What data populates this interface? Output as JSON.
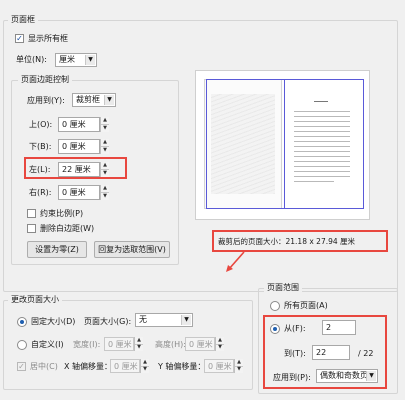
{
  "page_boxes": {
    "legend": "页面框",
    "show_all_boxes_label": "显示所有框",
    "show_all_boxes_checked": true,
    "unit_label": "单位(N):",
    "unit_value": "厘米"
  },
  "margins": {
    "legend": "页面边距控制",
    "apply_to_label": "应用到(Y):",
    "apply_to_value": "裁剪框",
    "top_label": "上(O):",
    "top_value": "0 厘米",
    "bottom_label": "下(B):",
    "bottom_value": "0 厘米",
    "left_label": "左(L):",
    "left_value": "22 厘米",
    "right_label": "右(R):",
    "right_value": "0 厘米",
    "constrain_label": "约束比例(P)",
    "remove_white_label": "删除白边距(W)",
    "set_zero_button": "设置为零(Z)",
    "revert_button": "回复为选取范围(V)"
  },
  "preview": {
    "cropped_size_text": "裁剪后的页面大小：21.18 x 27.94 厘米"
  },
  "change_size": {
    "legend": "更改页面大小",
    "fixed_label": "固定大小(D)",
    "page_size_label": "页面大小(G):",
    "page_size_value": "无",
    "custom_label": "自定义(I)",
    "width_label": "宽度(I):",
    "width_value": "0 厘米",
    "height_label": "高度(H):",
    "height_value": "0 厘米",
    "center_label": "居中(C)",
    "x_offset_label": "X 轴偏移量：",
    "x_offset_value": "0 厘米",
    "y_offset_label": "Y 轴偏移量：",
    "y_offset_value": "0 厘米"
  },
  "page_range": {
    "legend": "页面范围",
    "all_pages_label": "所有页面(A)",
    "from_label": "从(F):",
    "from_value": "2",
    "to_label": "到(T):",
    "to_value": "22",
    "total_text": "/ 22",
    "apply_to_label": "应用到(P):",
    "apply_to_value": "偶数和奇数页"
  },
  "colors": {
    "highlight_red": "#e8473f",
    "preview_border": "#5a5ad8"
  }
}
